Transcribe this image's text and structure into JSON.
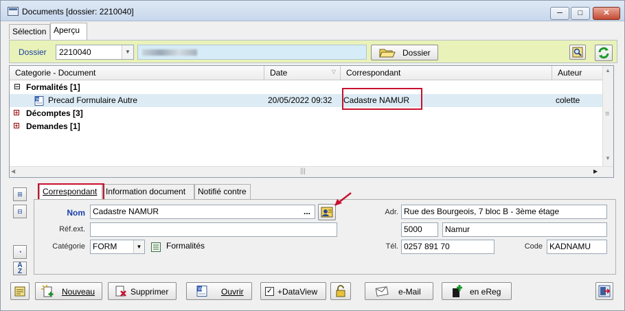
{
  "window": {
    "title": "Documents  [dossier: 2210040]",
    "min_glyph": "─",
    "max_glyph": "□",
    "close_glyph": "✕"
  },
  "main_tabs": [
    {
      "label": "Sélection",
      "active": false
    },
    {
      "label": "Aperçu",
      "active": true
    }
  ],
  "dossier": {
    "label": "Dossier",
    "number": "2210040",
    "button_label": "Dossier"
  },
  "grid": {
    "columns": [
      "Categorie - Document",
      "Date",
      "Correspondant",
      "Auteur"
    ],
    "groups": [
      {
        "label": "Formalités [1]",
        "expanded": true,
        "expander": "⊟"
      },
      {
        "label": "Décomptes [3]",
        "expanded": false,
        "expander": "+"
      },
      {
        "label": "Demandes [1]",
        "expanded": false,
        "expander": "+"
      }
    ],
    "row": {
      "document": "Precad Formulaire Autre",
      "date": "20/05/2022 09:32",
      "correspondant": "Cadastre NAMUR",
      "auteur": "colette"
    },
    "vscroll_up": "▲",
    "vscroll_down": "▼",
    "hscroll_left": "◀",
    "hscroll_right": "▶",
    "grip": "≡"
  },
  "lower_tabs": [
    {
      "label": "Correspondant",
      "active": true
    },
    {
      "label": "Information document",
      "active": false
    },
    {
      "label": "Notifié contre",
      "active": false
    }
  ],
  "correspondant": {
    "nom_label": "Nom",
    "nom_value": "Cadastre NAMUR",
    "ellipsis": "...",
    "refext_label": "Réf.ext.",
    "refext_value": "",
    "categorie_label": "Catégorie",
    "categorie_value": "FORM",
    "categorie_group": "Formalités",
    "adr_label": "Adr.",
    "adr_value": "Rue des Bourgeois, 7 bloc B - 3ème étage",
    "postal": "5000",
    "city": "Namur",
    "tel_label": "Tél.",
    "tel_value": "0257 891 70",
    "code_label": "Code",
    "code_value": "KADNAMU"
  },
  "bottom_buttons": {
    "nouveau": "Nouveau",
    "supprimer": "Supprimer",
    "ouvrir": "Ouvrir",
    "dataview": "+DataView",
    "email": "e-Mail",
    "ereg": "en eReg"
  },
  "colors": {
    "highlight": "#c8102e",
    "dossier_bar": "#e9f2b8",
    "selected_row": "#dcebf4"
  }
}
